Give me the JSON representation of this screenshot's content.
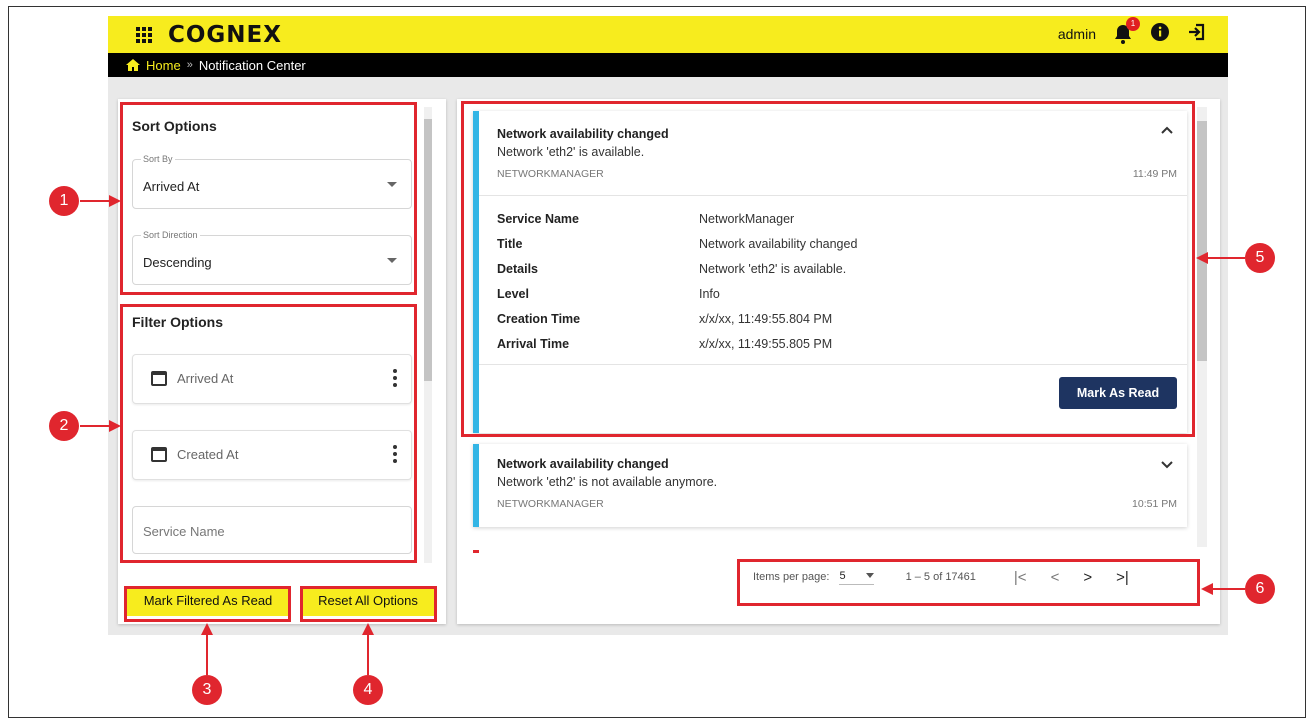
{
  "header": {
    "brand": "COGNEX",
    "user": "admin",
    "notification_badge": "1",
    "icons": [
      "apps-grid-icon",
      "bell-icon",
      "info-icon",
      "logout-icon"
    ]
  },
  "breadcrumb": {
    "home": "Home",
    "separator": "»",
    "current": "Notification Center"
  },
  "sort_options": {
    "title": "Sort Options",
    "sort_by_label": "Sort By",
    "sort_by_value": "Arrived At",
    "sort_direction_label": "Sort Direction",
    "sort_direction_value": "Descending"
  },
  "filter_options": {
    "title": "Filter Options",
    "arrived_at": "Arrived At",
    "created_at": "Created At",
    "service_name": "Service Name"
  },
  "left_buttons": {
    "mark_filtered": "Mark Filtered As Read",
    "reset_all": "Reset All Options"
  },
  "notifications": [
    {
      "title": "Network availability changed",
      "message": "Network 'eth2' is available.",
      "source": "NETWORKMANAGER",
      "time": "11:49 PM",
      "expanded": true,
      "details": [
        {
          "label": "Service Name",
          "value": "NetworkManager"
        },
        {
          "label": "Title",
          "value": "Network availability changed"
        },
        {
          "label": "Details",
          "value": "Network 'eth2' is available."
        },
        {
          "label": "Level",
          "value": "Info"
        },
        {
          "label": "Creation Time",
          "value": "x/x/xx, 11:49:55.804 PM"
        },
        {
          "label": "Arrival Time",
          "value": "x/x/xx, 11:49:55.805 PM"
        }
      ],
      "action": "Mark As Read"
    },
    {
      "title": "Network availability changed",
      "message": "Network 'eth2' is not available anymore.",
      "source": "NETWORKMANAGER",
      "time": "10:51 PM",
      "expanded": false
    }
  ],
  "paginator": {
    "items_per_page_label": "Items per page:",
    "items_per_page_value": "5",
    "range": "1 – 5 of 17461"
  },
  "callouts": [
    "1",
    "2",
    "3",
    "4",
    "5",
    "6"
  ],
  "colors": {
    "brand_yellow": "#f7ec1e",
    "callout_red": "#e0262e",
    "accent_blue": "#33b5e5",
    "button_navy": "#1e3461"
  }
}
